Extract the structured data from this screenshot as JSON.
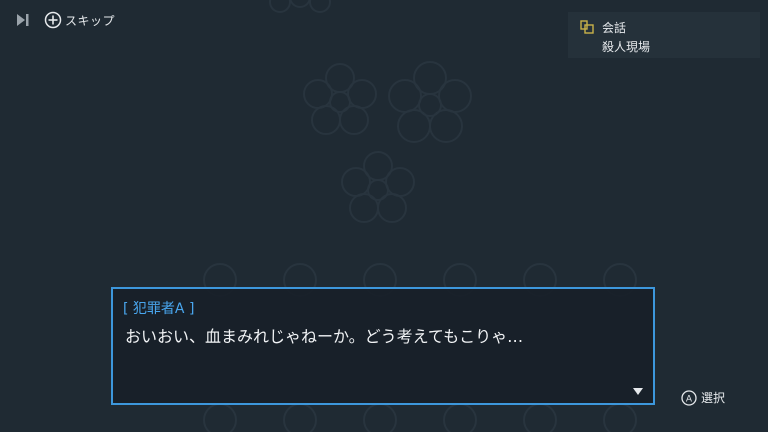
{
  "controls": {
    "skip_label": "スキップ"
  },
  "info_panel": {
    "line1": "会話",
    "line2": "殺人現場"
  },
  "dialogue": {
    "speaker": "[ 犯罪者A ]",
    "text": "おいおい、血まみれじゃねーか。どう考えてもこりゃ…"
  },
  "prompt": {
    "select_label": "選択"
  },
  "colors": {
    "background": "#1f2a33",
    "accent_blue": "#3d97dc",
    "speaker_blue": "#49a6ee",
    "text": "#e6e9ec"
  },
  "icons": {
    "skip": "skip-forward-icon",
    "plus_button": "plus-button-icon",
    "conversation": "conversation-icon",
    "advance": "advance-triangle-icon",
    "a_button": "a-button-icon"
  }
}
